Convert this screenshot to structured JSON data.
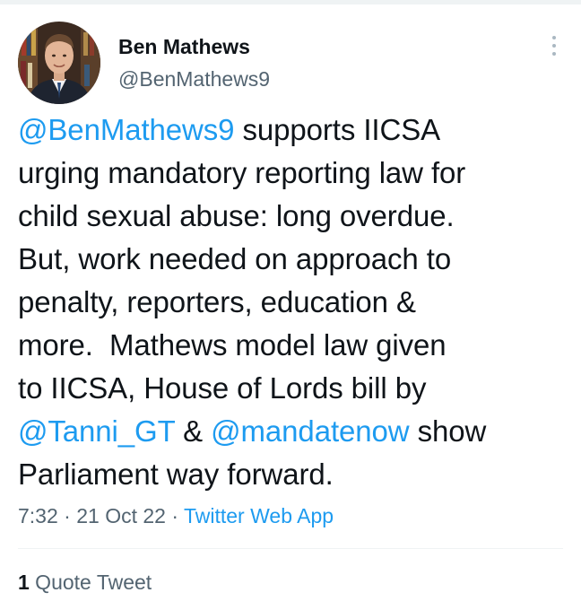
{
  "user": {
    "display_name": "Ben Mathews",
    "handle": "@BenMathews9"
  },
  "tweet": {
    "lines": [
      [
        {
          "t": "@BenMathews9",
          "m": true
        },
        {
          "t": " supports IICSA",
          "m": false
        }
      ],
      [
        {
          "t": "urging mandatory reporting law for",
          "m": false
        }
      ],
      [
        {
          "t": "child sexual abuse: long overdue.",
          "m": false
        }
      ],
      [
        {
          "t": "But, work needed on approach to",
          "m": false
        }
      ],
      [
        {
          "t": "penalty, reporters, education &",
          "m": false
        }
      ],
      [
        {
          "t": "more.  Mathews model law given",
          "m": false
        }
      ],
      [
        {
          "t": "to IICSA, House of Lords bill by",
          "m": false
        }
      ],
      [
        {
          "t": "@Tanni_GT",
          "m": true
        },
        {
          "t": " & ",
          "m": false
        },
        {
          "t": "@mandatenow",
          "m": true
        },
        {
          "t": " show",
          "m": false
        }
      ],
      [
        {
          "t": "Parliament way forward.",
          "m": false
        }
      ]
    ]
  },
  "meta": {
    "time": "7:32",
    "sep1": " · ",
    "date": "21 Oct 22",
    "sep2": " · ",
    "source": "Twitter Web App"
  },
  "quotes": {
    "count": "1",
    "label": " Quote Tweet"
  },
  "icons": {
    "more": "more-vertical-icon",
    "avatar": "profile-photo"
  },
  "colors": {
    "link": "#1d9bf0",
    "secondary": "#536471",
    "text": "#0f1419"
  }
}
